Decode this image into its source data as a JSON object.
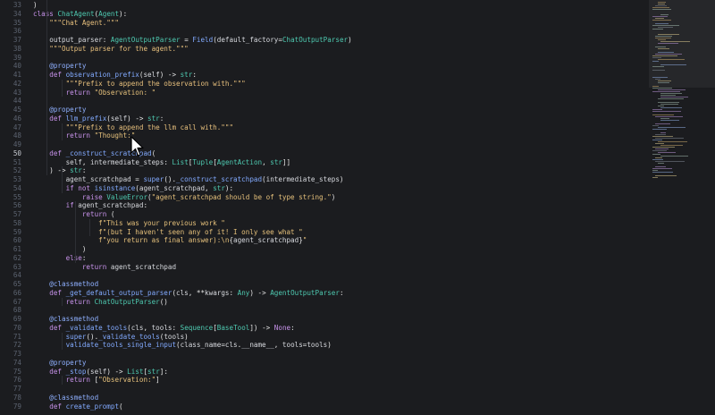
{
  "editor": {
    "current_line": 50,
    "lines": [
      {
        "n": "33",
        "t": [
          [
            "pm",
            ")"
          ]
        ]
      },
      {
        "n": "34",
        "t": [
          [
            "kw",
            "class "
          ],
          [
            "ty",
            "ChatAgent"
          ],
          [
            "pm",
            "("
          ],
          [
            "ty",
            "Agent"
          ],
          [
            "pm",
            "):"
          ]
        ]
      },
      {
        "n": "35",
        "t": [
          [
            "dc",
            "    \"\"\"Chat Agent.\"\"\""
          ]
        ]
      },
      {
        "n": "36",
        "t": []
      },
      {
        "n": "37",
        "t": [
          [
            "sf",
            "    output_parser"
          ],
          [
            "pm",
            ": "
          ],
          [
            "ty",
            "AgentOutputParser"
          ],
          [
            "pm",
            " = "
          ],
          [
            "fn",
            "Field"
          ],
          [
            "pm",
            "("
          ],
          [
            "sf",
            "default_factory"
          ],
          [
            "pm",
            "="
          ],
          [
            "ty",
            "ChatOutputParser"
          ],
          [
            "pm",
            ")"
          ]
        ]
      },
      {
        "n": "38",
        "t": [
          [
            "dc",
            "    \"\"\"Output parser for the agent.\"\"\""
          ]
        ]
      },
      {
        "n": "39",
        "t": []
      },
      {
        "n": "40",
        "t": [
          [
            "dec",
            "    @property"
          ]
        ]
      },
      {
        "n": "41",
        "t": [
          [
            "kw",
            "    def "
          ],
          [
            "fn",
            "observation_prefix"
          ],
          [
            "pm",
            "("
          ],
          [
            "sf",
            "self"
          ],
          [
            "pm",
            ") -> "
          ],
          [
            "ty",
            "str"
          ],
          [
            "pm",
            ":"
          ]
        ]
      },
      {
        "n": "42",
        "t": [
          [
            "dc",
            "        \"\"\"Prefix to append the observation with.\"\"\""
          ]
        ]
      },
      {
        "n": "43",
        "t": [
          [
            "kw",
            "        return "
          ],
          [
            "st",
            "\"Observation: \""
          ]
        ]
      },
      {
        "n": "44",
        "t": []
      },
      {
        "n": "45",
        "t": [
          [
            "dec",
            "    @property"
          ]
        ]
      },
      {
        "n": "46",
        "t": [
          [
            "kw",
            "    def "
          ],
          [
            "fn",
            "llm_prefix"
          ],
          [
            "pm",
            "("
          ],
          [
            "sf",
            "self"
          ],
          [
            "pm",
            ") -> "
          ],
          [
            "ty",
            "str"
          ],
          [
            "pm",
            ":"
          ]
        ]
      },
      {
        "n": "47",
        "t": [
          [
            "dc",
            "        \"\"\"Prefix to append the llm call with.\"\"\""
          ]
        ]
      },
      {
        "n": "48",
        "t": [
          [
            "kw",
            "        return "
          ],
          [
            "st",
            "\"Thought:\""
          ]
        ]
      },
      {
        "n": "49",
        "t": []
      },
      {
        "n": "50",
        "t": [
          [
            "kw",
            "    def "
          ],
          [
            "fn",
            "_construct_scratchpad"
          ],
          [
            "pm",
            "("
          ]
        ]
      },
      {
        "n": "51",
        "t": [
          [
            "sf",
            "        self"
          ],
          [
            "pm",
            ", "
          ],
          [
            "sf",
            "intermediate_steps"
          ],
          [
            "pm",
            ": "
          ],
          [
            "ty",
            "List"
          ],
          [
            "pm",
            "["
          ],
          [
            "ty",
            "Tuple"
          ],
          [
            "pm",
            "["
          ],
          [
            "ty",
            "AgentAction"
          ],
          [
            "pm",
            ", "
          ],
          [
            "ty",
            "str"
          ],
          [
            "pm",
            "]]"
          ]
        ]
      },
      {
        "n": "52",
        "t": [
          [
            "pm",
            "    ) -> "
          ],
          [
            "ty",
            "str"
          ],
          [
            "pm",
            ":"
          ]
        ]
      },
      {
        "n": "53",
        "t": [
          [
            "sf",
            "        agent_scratchpad"
          ],
          [
            "pm",
            " = "
          ],
          [
            "fn",
            "super"
          ],
          [
            "pm",
            "()."
          ],
          [
            "fn",
            "_construct_scratchpad"
          ],
          [
            "pm",
            "("
          ],
          [
            "sf",
            "intermediate_steps"
          ],
          [
            "pm",
            ")"
          ]
        ]
      },
      {
        "n": "54",
        "t": [
          [
            "kw",
            "        if not "
          ],
          [
            "fn",
            "isinstance"
          ],
          [
            "pm",
            "("
          ],
          [
            "sf",
            "agent_scratchpad"
          ],
          [
            "pm",
            ", "
          ],
          [
            "ty",
            "str"
          ],
          [
            "pm",
            "):"
          ]
        ]
      },
      {
        "n": "55",
        "t": [
          [
            "kw",
            "            raise "
          ],
          [
            "ty",
            "ValueError"
          ],
          [
            "pm",
            "("
          ],
          [
            "st",
            "\"agent_scratchpad should be of type string.\""
          ],
          [
            "pm",
            ")"
          ]
        ]
      },
      {
        "n": "56",
        "t": [
          [
            "kw",
            "        if "
          ],
          [
            "sf",
            "agent_scratchpad"
          ],
          [
            "pm",
            ":"
          ]
        ]
      },
      {
        "n": "57",
        "t": [
          [
            "kw",
            "            return "
          ],
          [
            "pm",
            "("
          ]
        ]
      },
      {
        "n": "58",
        "t": [
          [
            "st",
            "                f\"This was your previous work \""
          ]
        ]
      },
      {
        "n": "59",
        "t": [
          [
            "st",
            "                f\"(but I haven't seen any of it! I only see what \""
          ]
        ]
      },
      {
        "n": "60",
        "t": [
          [
            "st",
            "                f\"you return as final answer):\\n"
          ],
          [
            "pm",
            "{"
          ],
          [
            "sf",
            "agent_scratchpad"
          ],
          [
            "pm",
            "}"
          ],
          [
            "st",
            "\""
          ]
        ]
      },
      {
        "n": "61",
        "t": [
          [
            "pm",
            "            )"
          ]
        ]
      },
      {
        "n": "62",
        "t": [
          [
            "kw",
            "        else"
          ],
          [
            "pm",
            ":"
          ]
        ]
      },
      {
        "n": "63",
        "t": [
          [
            "kw",
            "            return "
          ],
          [
            "sf",
            "agent_scratchpad"
          ]
        ]
      },
      {
        "n": "64",
        "t": []
      },
      {
        "n": "65",
        "t": [
          [
            "dec",
            "    @classmethod"
          ]
        ]
      },
      {
        "n": "66",
        "t": [
          [
            "kw",
            "    def "
          ],
          [
            "fn",
            "_get_default_output_parser"
          ],
          [
            "pm",
            "("
          ],
          [
            "sf",
            "cls"
          ],
          [
            "pm",
            ", **"
          ],
          [
            "sf",
            "kwargs"
          ],
          [
            "pm",
            ": "
          ],
          [
            "ty",
            "Any"
          ],
          [
            "pm",
            ") -> "
          ],
          [
            "ty",
            "AgentOutputParser"
          ],
          [
            "pm",
            ":"
          ]
        ]
      },
      {
        "n": "67",
        "t": [
          [
            "kw",
            "        return "
          ],
          [
            "ty",
            "ChatOutputParser"
          ],
          [
            "pm",
            "()"
          ]
        ]
      },
      {
        "n": "68",
        "t": []
      },
      {
        "n": "69",
        "t": [
          [
            "dec",
            "    @classmethod"
          ]
        ]
      },
      {
        "n": "70",
        "t": [
          [
            "kw",
            "    def "
          ],
          [
            "fn",
            "_validate_tools"
          ],
          [
            "pm",
            "("
          ],
          [
            "sf",
            "cls"
          ],
          [
            "pm",
            ", "
          ],
          [
            "sf",
            "tools"
          ],
          [
            "pm",
            ": "
          ],
          [
            "ty",
            "Sequence"
          ],
          [
            "pm",
            "["
          ],
          [
            "ty",
            "BaseTool"
          ],
          [
            "pm",
            "]) -> "
          ],
          [
            "kw",
            "None"
          ],
          [
            "pm",
            ":"
          ]
        ]
      },
      {
        "n": "71",
        "t": [
          [
            "fn",
            "        super"
          ],
          [
            "pm",
            "()."
          ],
          [
            "fn",
            "_validate_tools"
          ],
          [
            "pm",
            "("
          ],
          [
            "sf",
            "tools"
          ],
          [
            "pm",
            ")"
          ]
        ]
      },
      {
        "n": "72",
        "t": [
          [
            "fn",
            "        validate_tools_single_input"
          ],
          [
            "pm",
            "("
          ],
          [
            "sf",
            "class_name"
          ],
          [
            "pm",
            "="
          ],
          [
            "sf",
            "cls"
          ],
          [
            "pm",
            "."
          ],
          [
            "sf",
            "__name__"
          ],
          [
            "pm",
            ", "
          ],
          [
            "sf",
            "tools"
          ],
          [
            "pm",
            "="
          ],
          [
            "sf",
            "tools"
          ],
          [
            "pm",
            ")"
          ]
        ]
      },
      {
        "n": "73",
        "t": []
      },
      {
        "n": "74",
        "t": [
          [
            "dec",
            "    @property"
          ]
        ]
      },
      {
        "n": "75",
        "t": [
          [
            "kw",
            "    def "
          ],
          [
            "fn",
            "_stop"
          ],
          [
            "pm",
            "("
          ],
          [
            "sf",
            "self"
          ],
          [
            "pm",
            ") -> "
          ],
          [
            "ty",
            "List"
          ],
          [
            "pm",
            "["
          ],
          [
            "ty",
            "str"
          ],
          [
            "pm",
            "]:"
          ]
        ]
      },
      {
        "n": "76",
        "t": [
          [
            "kw",
            "        return "
          ],
          [
            "pm",
            "["
          ],
          [
            "st",
            "\"Observation:\""
          ],
          [
            "pm",
            "]"
          ]
        ]
      },
      {
        "n": "77",
        "t": []
      },
      {
        "n": "78",
        "t": [
          [
            "dec",
            "    @classmethod"
          ]
        ]
      },
      {
        "n": "79",
        "t": [
          [
            "kw",
            "    def "
          ],
          [
            "fn",
            "create_prompt"
          ],
          [
            "pm",
            "("
          ]
        ]
      }
    ]
  },
  "colors": {
    "background": "#1b1c1f",
    "keyword": "#c792ea",
    "function": "#82aaff",
    "type": "#4ec9b0",
    "string": "#e5c07b",
    "decorator": "#8fb0ff"
  },
  "icons": {
    "cursor": "mouse-pointer-icon"
  }
}
